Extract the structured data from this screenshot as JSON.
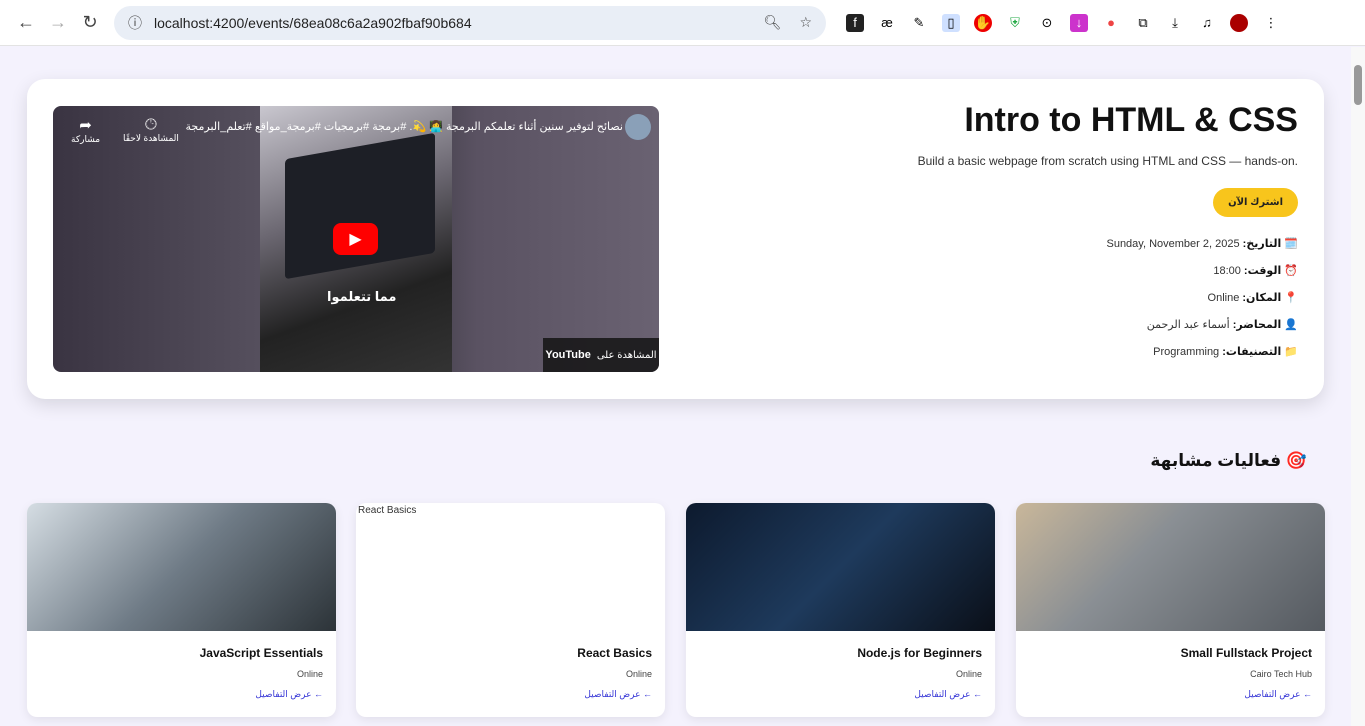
{
  "browser": {
    "url": "localhost:4200/events/68ea08c6a2a902fbaf90b684"
  },
  "event": {
    "title": "Intro to HTML & CSS",
    "description": "Build a basic webpage from scratch using HTML and CSS — hands-on.",
    "join_label": "اشترك الآن",
    "details": [
      {
        "icon": "🗓️",
        "label": "التاريخ:",
        "value": "Sunday, November 2, 2025"
      },
      {
        "icon": "⏰",
        "label": "الوقت:",
        "value": "18:00"
      },
      {
        "icon": "📍",
        "label": "المكان:",
        "value": "Online"
      },
      {
        "icon": "👤",
        "label": "المحاضر:",
        "value": "أسماء عبد الرحمن"
      },
      {
        "icon": "📁",
        "label": "التصنيفات:",
        "value": "Programming"
      }
    ]
  },
  "video": {
    "title": "نصائح لتوفير سنين أثناء تعلمكم البرمجة 👩‍💻 💫. #برمجة #برمجيات #برمجة_مواقع #تعلم_البرمجة",
    "watch_later": "المشاهدة لاحقًا",
    "share": "مشاركة",
    "subtitle": "مما تتعلموا",
    "watch_on": "المشاهدة على",
    "youtube": "YouTube"
  },
  "similar": {
    "heading": "🎯 فعاليات مشابهة",
    "details_link": "← عرض التفاصيل",
    "cards": [
      {
        "title": "Small Fullstack Project",
        "location": "Cairo Tech Hub"
      },
      {
        "title": "Node.js for Beginners",
        "location": "Online"
      },
      {
        "title": "React Basics",
        "location": "Online",
        "alt": "React Basics"
      },
      {
        "title": "JavaScript Essentials",
        "location": "Online"
      }
    ]
  }
}
